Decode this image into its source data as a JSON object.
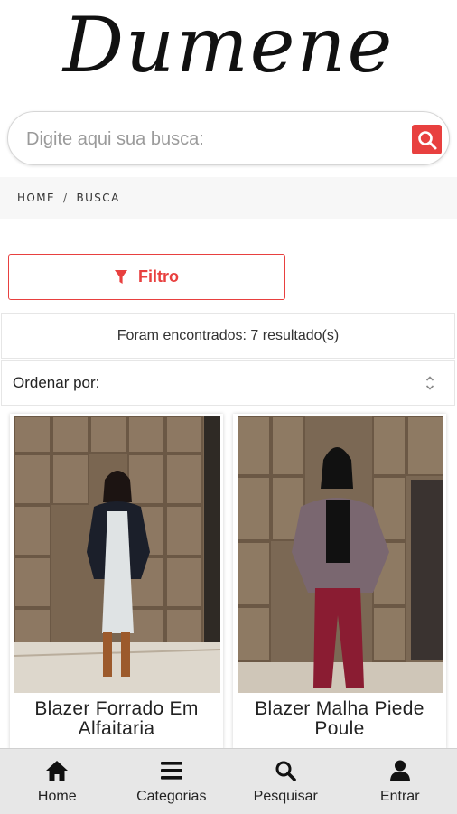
{
  "brand": {
    "logo_text": "Dumene"
  },
  "search": {
    "placeholder": "Digite aqui sua busca:",
    "icon": "search-icon",
    "button_color": "#e8403f"
  },
  "breadcrumb": {
    "items": [
      "HOME",
      "BUSCA"
    ],
    "separator": "/"
  },
  "filter": {
    "label": "Filtro",
    "icon": "filter-icon"
  },
  "results": {
    "text": "Foram encontrados: 7 resultado(s)"
  },
  "sort": {
    "label": "Ordenar por:",
    "icon": "chevron-updown-icon"
  },
  "products": [
    {
      "title": "Blazer Forrado Em Alfaitaria",
      "image": "photo of model wearing black blazer and white dress"
    },
    {
      "title": "Blazer Malha Piede Poule",
      "image": "photo of model wearing houndstooth blazer and burgundy pants"
    }
  ],
  "bottom_nav": [
    {
      "label": "Home",
      "icon": "home-icon"
    },
    {
      "label": "Categorias",
      "icon": "menu-icon"
    },
    {
      "label": "Pesquisar",
      "icon": "search-icon"
    },
    {
      "label": "Entrar",
      "icon": "user-icon"
    }
  ],
  "colors": {
    "accent": "#e8403f",
    "nav_bg": "#e7e7e7",
    "breadcrumb_bg": "#f7f7f7"
  }
}
